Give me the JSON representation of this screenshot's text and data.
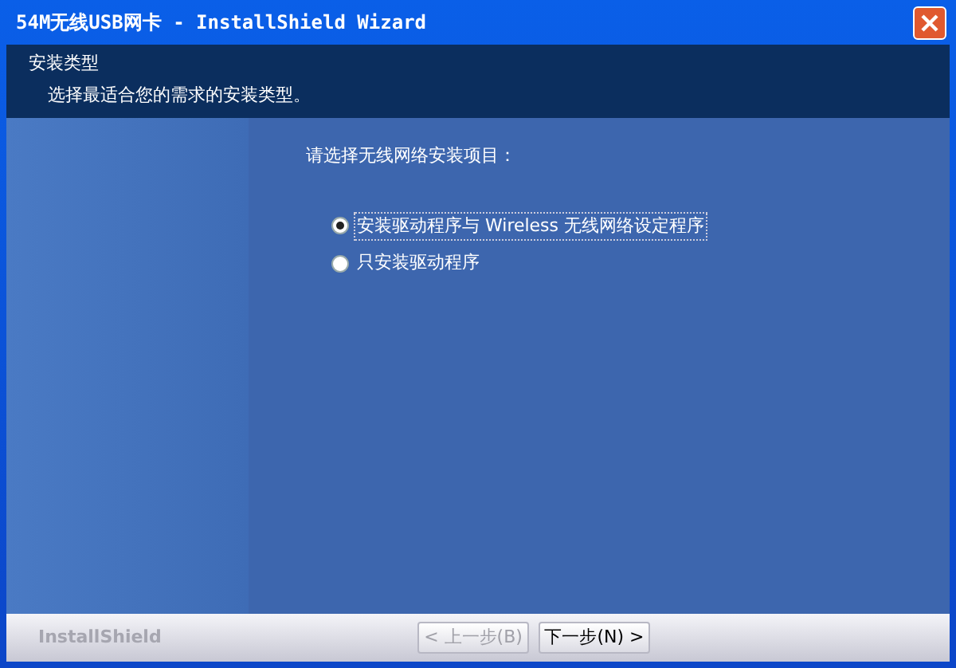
{
  "window": {
    "title": "54M无线USB网卡 - InstallShield Wizard"
  },
  "header": {
    "title": "安装类型",
    "subtitle": "选择最适合您的需求的安装类型。"
  },
  "prompt": "请选择无线网络安装项目：",
  "options": [
    {
      "label": "安装驱动程序与 Wireless 无线网络设定程序",
      "selected": true
    },
    {
      "label": "只安装驱动程序",
      "selected": false
    }
  ],
  "footer": {
    "brand": "InstallShield"
  },
  "buttons": [
    {
      "label": "< 上一步(B)",
      "disabled": true
    },
    {
      "label": "下一步(N) >",
      "disabled": false
    }
  ]
}
